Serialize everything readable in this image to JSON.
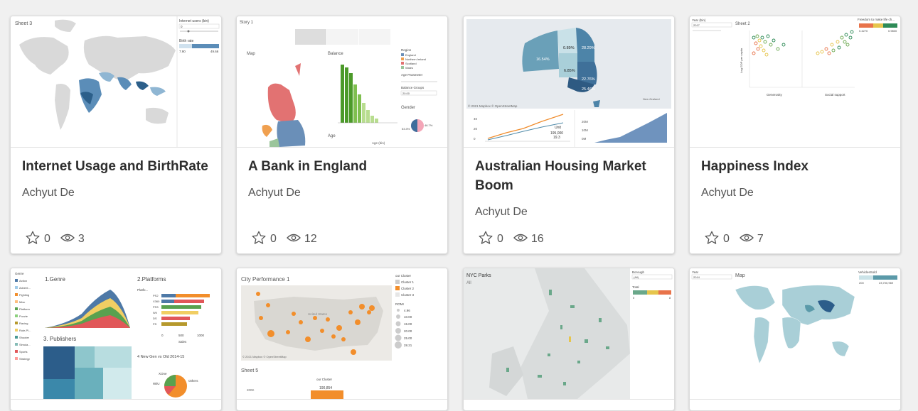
{
  "cards": [
    {
      "title": "Internet Usage and BirthRate",
      "author": "Achyut De",
      "favorites": "0",
      "views": "3",
      "thumb": {
        "sheet": "Sheet 3",
        "legend1": "Internet users (bin)",
        "legend2": "Birth rate",
        "lo": "7.90",
        "hi": "49.66",
        "slider_val": "0"
      }
    },
    {
      "title": "A Bank in England",
      "author": "Achyut De",
      "favorites": "0",
      "views": "12",
      "thumb": {
        "story": "Story 1",
        "map": "Map",
        "balance": "Balance",
        "gender": "Gender",
        "age": "Age",
        "age_bin": "Age (bin)",
        "region": "Region",
        "regions": [
          "England",
          "Northern Ireland",
          "Scotland",
          "Wales"
        ],
        "pct_a": "53.3%",
        "pct_b": "46.7%",
        "age_param": "Age Parameter",
        "balance_groups": "Balance Groups",
        "balance_val": "20.00"
      }
    },
    {
      "title": "Australian Housing Market Boom",
      "author": "Achyut De",
      "favorites": "0",
      "views": "16",
      "thumb": {
        "p1": "0.89%",
        "p2": "28.29%",
        "p3": "16.54%",
        "p4": "6.85%",
        "p5": "22.76%",
        "p6": "25.46%",
        "copyright": "© 2021 Mapbox © OpenStreetMap",
        "nz": "New Zealand",
        "unit": "Unit",
        "unit_val": "195,000",
        "unit_sub": "19.3",
        "y1": "40",
        "y2": "20",
        "y3": "0",
        "r1": "20M",
        "r2": "10M",
        "r3": "0M",
        "ylab1": "Running Sum o...",
        "ylab2": "Running Sum o..."
      }
    },
    {
      "title": "Happiness Index",
      "author": "Achyut De",
      "favorites": "0",
      "views": "7",
      "thumb": {
        "year_label": "Year (bin)",
        "year": "2017",
        "sheet": "Sheet 2",
        "legend": "Freedom to make life ch...",
        "lo": "0.4270",
        "hi": "0.9800",
        "x1": "Generosity",
        "x2": "Social support",
        "ylab": "Log GDP per capita"
      }
    },
    {
      "thumb": {
        "genre_label": "Genre",
        "genres": [
          "Action",
          "Advent...",
          "Fighting",
          "Misc",
          "Platform",
          "Puzzle",
          "Racing",
          "Role-Pl...",
          "Shooter",
          "Simula...",
          "Sports",
          "Strategy"
        ],
        "g1": "1.Genre",
        "g2": "2.Platforms",
        "g3": "3. Publishers",
        "g4": "4 New Gen vs Old 2014-15",
        "platform": "Platfo...",
        "platforms": [
          "PS2",
          "X360",
          "PS3",
          "Wii",
          "DS",
          "PS"
        ],
        "sales": "Sales",
        "ticks": [
          "0",
          "500",
          "1000"
        ],
        "knew": "XOne",
        "wii": "WiiU",
        "others": "Others"
      }
    },
    {
      "thumb": {
        "title": "City Performance 1",
        "cluster": "our Cluster",
        "clusters": [
          "Cluster 1",
          "Cluster 2",
          "Cluster 3"
        ],
        "romi": "ROMI",
        "romi_vals": [
          "4.96",
          "10.00",
          "15.00",
          "20.00",
          "25.00",
          "28.21"
        ],
        "copyright": "© 2021 Mapbox © OpenStreetMap",
        "us": "United States",
        "sheet5": "Sheet 5",
        "cluster2": "our Cluster",
        "val": "190,854",
        "axis": "200K"
      }
    },
    {
      "thumb": {
        "title": "NYC Parks",
        "sub": "All",
        "borough": "Borough",
        "borough_val": "(All)",
        "total": "Total",
        "lo": "0",
        "hi": "8"
      }
    },
    {
      "thumb": {
        "year_label": "Year",
        "year": "2014",
        "map": "Map",
        "legend": "VehiclesSold",
        "lo": "200",
        "hi": "23,700,969"
      }
    }
  ]
}
